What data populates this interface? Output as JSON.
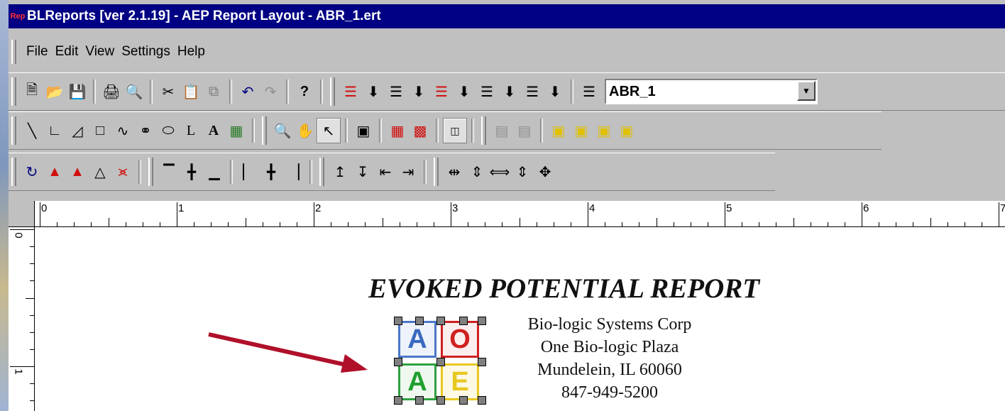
{
  "window": {
    "title": "BLReports [ver 2.1.19] - AEP Report Layout - ABR_1.ert",
    "app_icon": "Rep"
  },
  "menu": [
    "File",
    "Edit",
    "View",
    "Settings",
    "Help"
  ],
  "toolbar1": {
    "buttons": [
      "new-icon",
      "open-icon",
      "save-icon",
      "print-icon",
      "print-preview-icon",
      "cut-icon",
      "paste-icon",
      "copy-icon",
      "undo-icon",
      "redo-icon",
      "help-icon"
    ],
    "layout_buttons": [
      "band-move-1-icon",
      "band-move-2-icon",
      "band-move-3-icon",
      "band-move-4-icon",
      "band-move-5-icon",
      "band-list-icon"
    ],
    "template_select": "ABR_1"
  },
  "toolbar2": {
    "draw_buttons": [
      "line-icon",
      "right-angle-icon",
      "triangle-icon",
      "rectangle-icon",
      "curve-icon",
      "freeform-icon",
      "ellipse-icon",
      "l-shape-icon",
      "text-icon",
      "image-icon"
    ],
    "tool_buttons": [
      "zoom-icon",
      "pan-hand-icon",
      "pointer-icon",
      "properties-icon",
      "group-icon",
      "ungroup-icon",
      "frame-icon",
      "align-left-icon",
      "align-right-icon",
      "bring-front-icon",
      "bring-forward-icon",
      "send-backward-icon",
      "send-back-icon"
    ]
  },
  "toolbar3": {
    "buttons": [
      "rotate-icon",
      "flip-h-icon",
      "flip-v-icon",
      "mirror-icon",
      "skew-icon",
      "align-top-icon",
      "align-middle-icon",
      "align-bottom-icon",
      "align-left-edge-icon",
      "align-center-icon",
      "align-right-edge-icon",
      "fit-top-icon",
      "fit-bottom-icon",
      "fit-left-icon",
      "fit-right-icon",
      "space-h-icon",
      "space-v-icon",
      "same-width-icon",
      "same-height-icon",
      "same-size-icon"
    ]
  },
  "ruler": {
    "h_labels": [
      "0",
      "1",
      "2",
      "3",
      "4",
      "5",
      "6",
      "7"
    ],
    "v_labels": [
      "0",
      "1"
    ]
  },
  "report": {
    "title": "EVOKED POTENTIAL REPORT",
    "address": [
      "Bio-logic Systems Corp",
      "One Bio-logic Plaza",
      "Mundelein, IL 60060",
      "847-949-5200"
    ],
    "logo_letters": [
      "A",
      "O",
      "A",
      "E"
    ]
  },
  "colors": {
    "titlebar": "#000084",
    "arrow": "#b0102a"
  }
}
